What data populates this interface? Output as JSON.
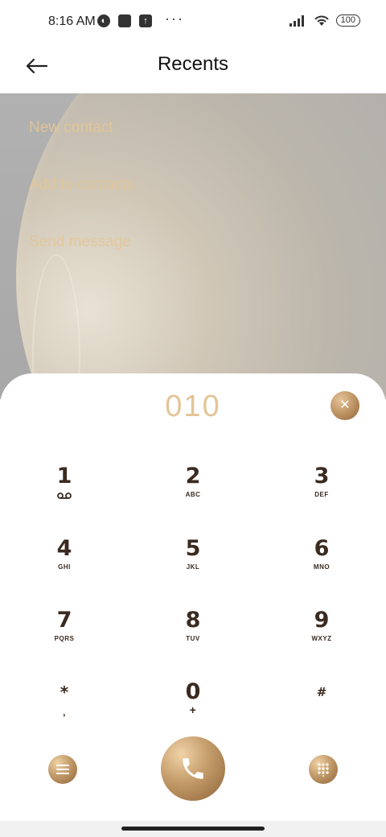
{
  "status_bar": {
    "time": "8:16 AM",
    "battery": "100",
    "icons": [
      "app-icon-1",
      "app-icon-2",
      "upload-icon",
      "more-dots-icon",
      "signal-icon",
      "wifi-icon",
      "battery-icon"
    ]
  },
  "header": {
    "title": "Recents"
  },
  "menu": {
    "items": [
      "New contact",
      "Add to contacts",
      "Send message"
    ]
  },
  "dialer": {
    "number": "010",
    "keys": [
      {
        "digit": "1",
        "letters": ""
      },
      {
        "digit": "2",
        "letters": "ABC"
      },
      {
        "digit": "3",
        "letters": "DEF"
      },
      {
        "digit": "4",
        "letters": "GHI"
      },
      {
        "digit": "5",
        "letters": "JKL"
      },
      {
        "digit": "6",
        "letters": "MNO"
      },
      {
        "digit": "7",
        "letters": "PQRS"
      },
      {
        "digit": "8",
        "letters": "TUV"
      },
      {
        "digit": "9",
        "letters": "WXYZ"
      },
      {
        "digit": "*",
        "letters": ","
      },
      {
        "digit": "0",
        "letters": "+"
      },
      {
        "digit": "#",
        "letters": ""
      }
    ]
  },
  "colors": {
    "accent": "#e3c597",
    "key_text": "#3b2a1f",
    "gold": "#b68a5a"
  }
}
